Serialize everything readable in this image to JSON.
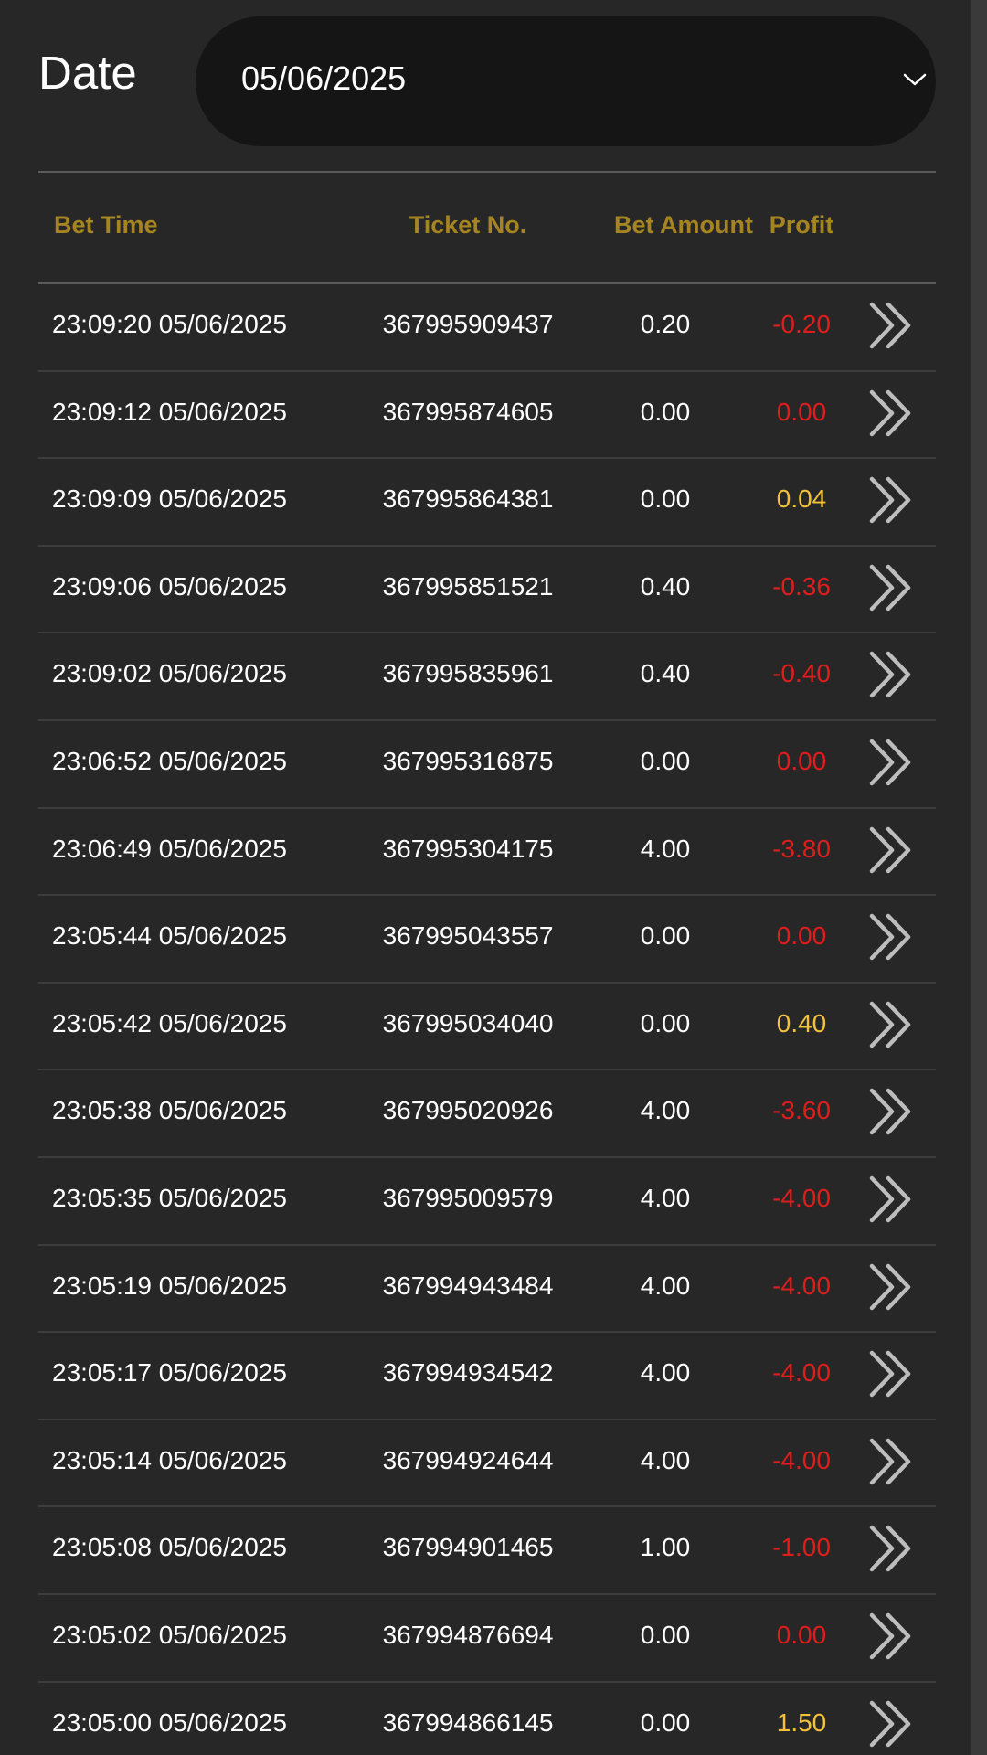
{
  "date_filter": {
    "label": "Date",
    "selected": "05/06/2025"
  },
  "table": {
    "headers": {
      "bet_time": "Bet Time",
      "ticket_no": "Ticket No.",
      "bet_amount": "Bet Amount",
      "profit": "Profit"
    },
    "rows": [
      {
        "bet_time": "23:09:20 05/06/2025",
        "ticket_no": "367995909437",
        "bet_amount": "0.20",
        "profit": "-0.20",
        "profit_state": "neg"
      },
      {
        "bet_time": "23:09:12 05/06/2025",
        "ticket_no": "367995874605",
        "bet_amount": "0.00",
        "profit": "0.00",
        "profit_state": "neg"
      },
      {
        "bet_time": "23:09:09 05/06/2025",
        "ticket_no": "367995864381",
        "bet_amount": "0.00",
        "profit": "0.04",
        "profit_state": "pos"
      },
      {
        "bet_time": "23:09:06 05/06/2025",
        "ticket_no": "367995851521",
        "bet_amount": "0.40",
        "profit": "-0.36",
        "profit_state": "neg"
      },
      {
        "bet_time": "23:09:02 05/06/2025",
        "ticket_no": "367995835961",
        "bet_amount": "0.40",
        "profit": "-0.40",
        "profit_state": "neg"
      },
      {
        "bet_time": "23:06:52 05/06/2025",
        "ticket_no": "367995316875",
        "bet_amount": "0.00",
        "profit": "0.00",
        "profit_state": "neg"
      },
      {
        "bet_time": "23:06:49 05/06/2025",
        "ticket_no": "367995304175",
        "bet_amount": "4.00",
        "profit": "-3.80",
        "profit_state": "neg"
      },
      {
        "bet_time": "23:05:44 05/06/2025",
        "ticket_no": "367995043557",
        "bet_amount": "0.00",
        "profit": "0.00",
        "profit_state": "neg"
      },
      {
        "bet_time": "23:05:42 05/06/2025",
        "ticket_no": "367995034040",
        "bet_amount": "0.00",
        "profit": "0.40",
        "profit_state": "pos"
      },
      {
        "bet_time": "23:05:38 05/06/2025",
        "ticket_no": "367995020926",
        "bet_amount": "4.00",
        "profit": "-3.60",
        "profit_state": "neg"
      },
      {
        "bet_time": "23:05:35 05/06/2025",
        "ticket_no": "367995009579",
        "bet_amount": "4.00",
        "profit": "-4.00",
        "profit_state": "neg"
      },
      {
        "bet_time": "23:05:19 05/06/2025",
        "ticket_no": "367994943484",
        "bet_amount": "4.00",
        "profit": "-4.00",
        "profit_state": "neg"
      },
      {
        "bet_time": "23:05:17 05/06/2025",
        "ticket_no": "367994934542",
        "bet_amount": "4.00",
        "profit": "-4.00",
        "profit_state": "neg"
      },
      {
        "bet_time": "23:05:14 05/06/2025",
        "ticket_no": "367994924644",
        "bet_amount": "4.00",
        "profit": "-4.00",
        "profit_state": "neg"
      },
      {
        "bet_time": "23:05:08 05/06/2025",
        "ticket_no": "367994901465",
        "bet_amount": "1.00",
        "profit": "-1.00",
        "profit_state": "neg"
      },
      {
        "bet_time": "23:05:02 05/06/2025",
        "ticket_no": "367994876694",
        "bet_amount": "0.00",
        "profit": "0.00",
        "profit_state": "neg"
      },
      {
        "bet_time": "23:05:00 05/06/2025",
        "ticket_no": "367994866145",
        "bet_amount": "0.00",
        "profit": "1.50",
        "profit_state": "pos"
      }
    ],
    "row_action_icon": "double-chevron-right-icon"
  },
  "colors": {
    "background": "#272727",
    "header_text": "#a58521",
    "profit_negative": "#e01d1d",
    "profit_positive": "#f3c23a"
  }
}
